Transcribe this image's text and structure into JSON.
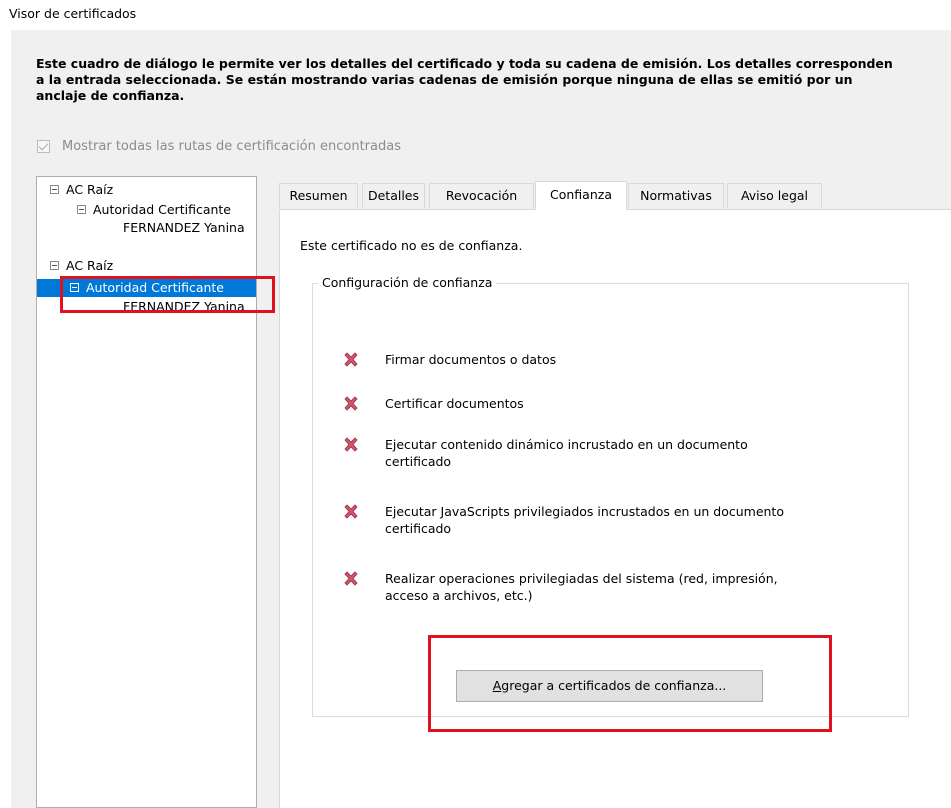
{
  "window": {
    "title": "Visor de certificados"
  },
  "description": "Este cuadro de diálogo le permite ver los detalles del certificado y toda su cadena de emisión. Los detalles corresponden\na la entrada seleccionada. Se están mostrando varias cadenas de emisión porque ninguna de ellas se emitió por un\nanclaje de confianza.",
  "show_all_paths": {
    "label": "Mostrar todas las rutas de certificación encontradas",
    "checked": true,
    "disabled": true
  },
  "tree": {
    "nodes": [
      {
        "label": "AC Raíz",
        "level": 0,
        "expandable": true,
        "selected": false
      },
      {
        "label": "Autoridad Certificante",
        "level": 1,
        "expandable": true,
        "selected": false
      },
      {
        "label": "FERNANDEZ Yanina",
        "level": 2,
        "expandable": false,
        "selected": false
      },
      {
        "label": "AC Raíz",
        "level": 0,
        "expandable": true,
        "selected": false
      },
      {
        "label": "Autoridad Certificante",
        "level": 1,
        "expandable": true,
        "selected": true
      },
      {
        "label": "FERNANDEZ Yanina",
        "level": 2,
        "expandable": false,
        "selected": false
      }
    ]
  },
  "tabs": [
    {
      "label": "Resumen",
      "active": false
    },
    {
      "label": "Detalles",
      "active": false
    },
    {
      "label": "Revocación",
      "active": false
    },
    {
      "label": "Confianza",
      "active": true
    },
    {
      "label": "Normativas",
      "active": false
    },
    {
      "label": "Aviso legal",
      "active": false
    }
  ],
  "trust": {
    "status": "Este certificado no es de confianza.",
    "group_title": "Configuración de confianza",
    "permissions": [
      {
        "text": "Firmar documentos o datos",
        "allowed": false,
        "icon": "x-icon"
      },
      {
        "text": "Certificar documentos",
        "allowed": false,
        "icon": "x-icon"
      },
      {
        "text": "Ejecutar contenido dinámico incrustado en un documento\ncertificado",
        "allowed": false,
        "icon": "x-icon"
      },
      {
        "text": "Ejecutar JavaScripts privilegiados incrustados en un documento\ncertificado",
        "allowed": false,
        "icon": "x-icon"
      },
      {
        "text": "Realizar operaciones privilegiadas del sistema (red, impresión,\nacceso a archivos, etc.)",
        "allowed": false,
        "icon": "x-icon"
      }
    ],
    "add_button": {
      "first_letter": "A",
      "rest": "gregar a certificados de confianza..."
    }
  },
  "colors": {
    "selection": "#0078d7",
    "highlight": "#e0121f",
    "deny_icon": "#d0546e"
  }
}
